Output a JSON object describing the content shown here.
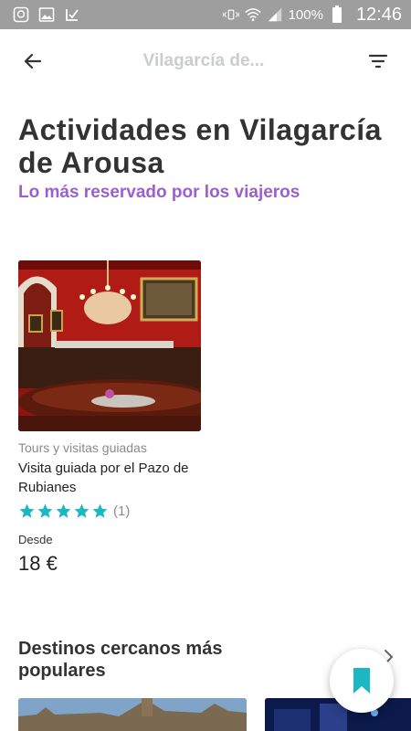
{
  "status_bar": {
    "battery": "100%",
    "time": "12:46",
    "icons": [
      "chat-bubble-icon",
      "image-icon",
      "download-check-icon",
      "vibrate-icon",
      "wifi-icon",
      "signal-icon",
      "battery-icon"
    ]
  },
  "app_bar": {
    "title": "Vilagarcía de...",
    "back_icon": "arrow-left-icon",
    "filter_icon": "filter-icon"
  },
  "header": {
    "title": "Actividades en Vilagarcía de Arousa",
    "subtitle": "Lo más reservado por los viajeros"
  },
  "activity": {
    "category": "Tours y visitas guiadas",
    "title": "Visita guiada por el Pazo de Rubianes",
    "rating_stars": 5,
    "review_count": "(1)",
    "price_label": "Desde",
    "price": "18 €"
  },
  "nearby": {
    "title": "Destinos cercanos más populares",
    "chevron_icon": "chevron-right-icon"
  },
  "fab": {
    "icon": "bookmark-icon"
  },
  "colors": {
    "accent_purple": "#9c5fd0",
    "star_teal": "#1bb7c2",
    "status_bar": "#9e9e9e"
  }
}
